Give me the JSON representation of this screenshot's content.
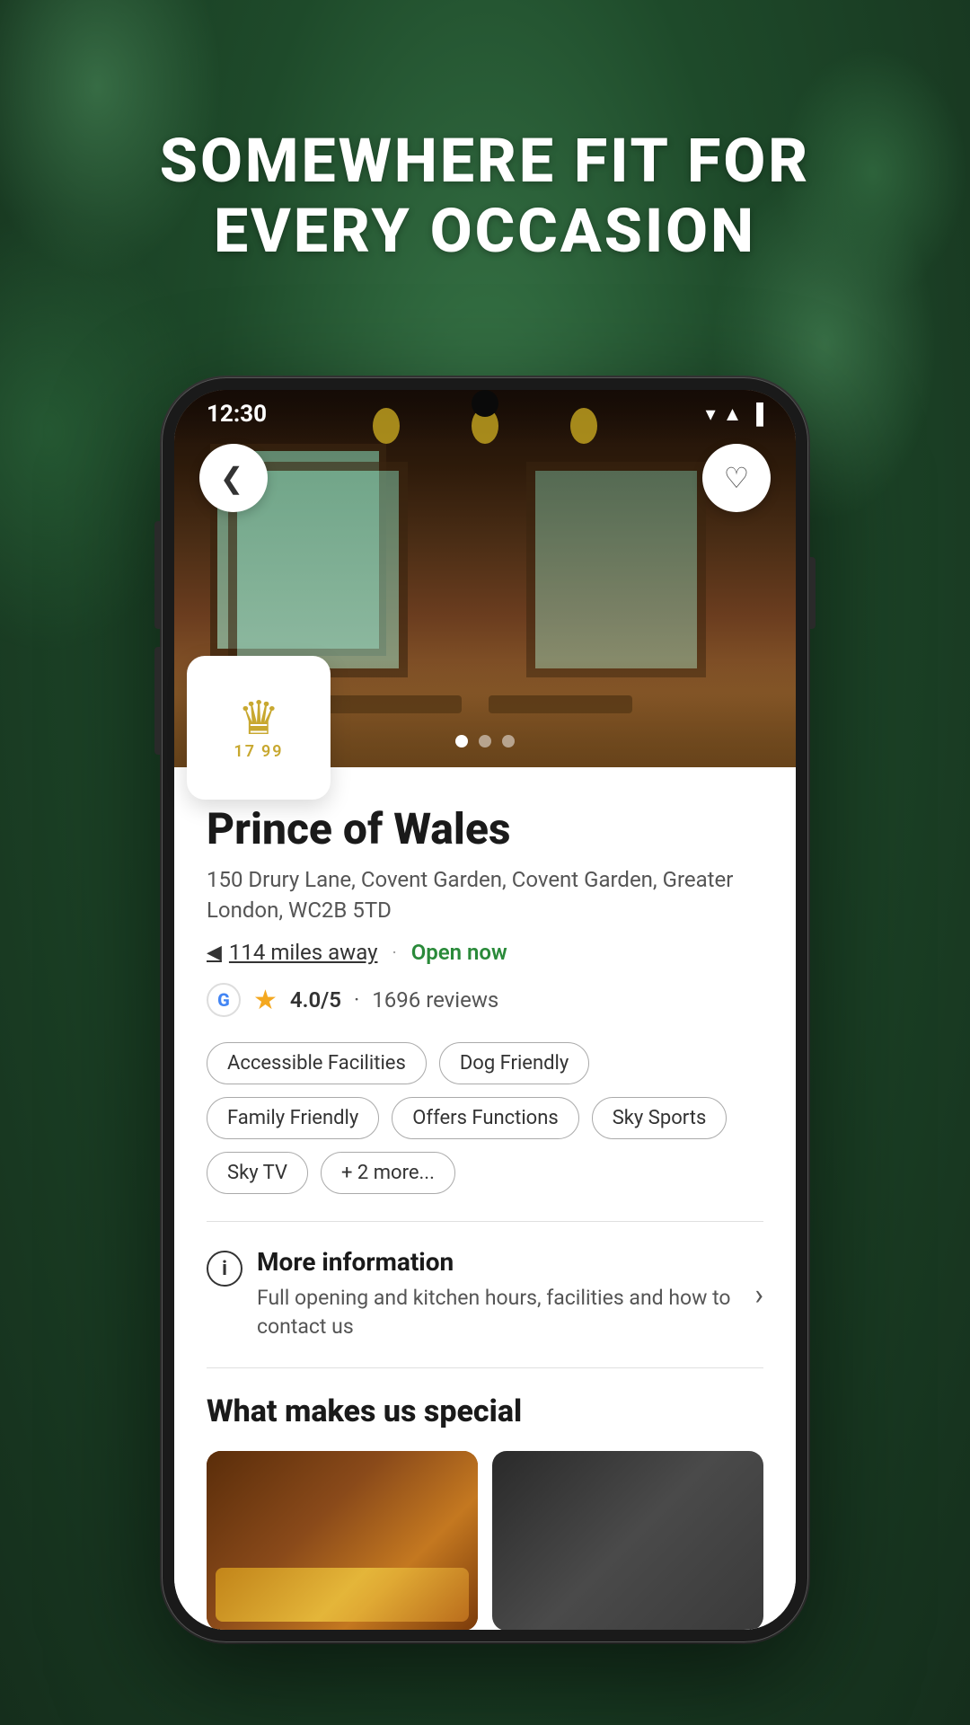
{
  "page": {
    "background_color": "#2d5a3d",
    "heading": "SOMEWHERE FIT FOR EVERY OCCASION"
  },
  "status_bar": {
    "time": "12:30",
    "wifi": "▼",
    "signal": "▲",
    "battery": "▐"
  },
  "hero": {
    "back_label": "‹",
    "heart_label": "♡",
    "dots": [
      true,
      false,
      false
    ]
  },
  "venue": {
    "logo_year_left": "17",
    "logo_year_right": "99",
    "name": "Prince of Wales",
    "address": "150 Drury Lane, Covent Garden, Covent Garden, Greater London, WC2B 5TD",
    "distance": "114 miles away",
    "open_status": "Open now",
    "rating": "4.0/5",
    "review_separator": "·",
    "reviews": "1696 reviews",
    "tags": [
      "Accessible Facilities",
      "Dog Friendly",
      "Family Friendly",
      "Offers Functions",
      "Sky Sports",
      "Sky TV",
      "+ 2 more..."
    ],
    "more_info": {
      "title": "More information",
      "description": "Full opening and kitchen hours, facilities and how to contact us"
    },
    "special_section_title": "What makes us special"
  },
  "icons": {
    "back": "❮",
    "heart": "♡",
    "location": "◀",
    "info": "i",
    "chevron_right": "›",
    "star": "★",
    "google_g": "G"
  }
}
